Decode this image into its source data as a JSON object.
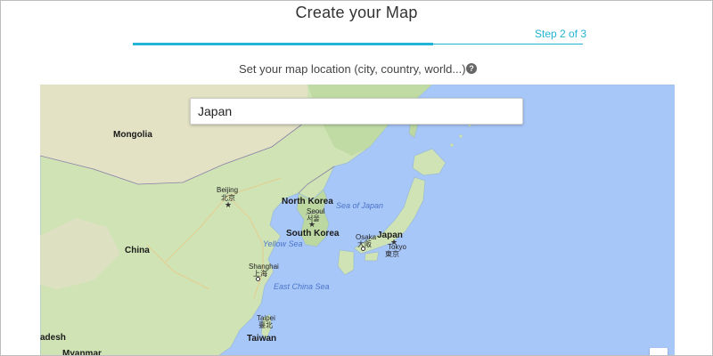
{
  "header": {
    "title": "Create your Map",
    "step": "Step 2 of 3",
    "progress_fraction": 0.667,
    "subtitle": "Set your map location (city, country, world...)",
    "help_icon": "question-circle-icon",
    "accent_color": "#23b3d6"
  },
  "map": {
    "search_value": "Japan",
    "water_color": "#a8c7f9",
    "land_color": "#cfe3b4",
    "labels": {
      "mongolia": "Mongolia",
      "beijing": "Beijing",
      "beijing_local": "北京",
      "north_korea": "North Korea",
      "sea_of_japan": "Sea of Japan",
      "seoul": "Seoul",
      "seoul_local": "서울",
      "south_korea": "South Korea",
      "yellow_sea": "Yellow Sea",
      "japan": "Japan",
      "osaka": "Osaka",
      "osaka_local": "大阪",
      "tokyo": "Tokyo",
      "tokyo_local": "東京",
      "china": "China",
      "shanghai": "Shanghai",
      "shanghai_local": "上海",
      "east_china_sea": "East China Sea",
      "taipei": "Taipei",
      "taipei_local": "臺北",
      "taiwan": "Taiwan",
      "bangladesh_partial": "adesh",
      "myanmar_partial": "Myanmar"
    }
  }
}
